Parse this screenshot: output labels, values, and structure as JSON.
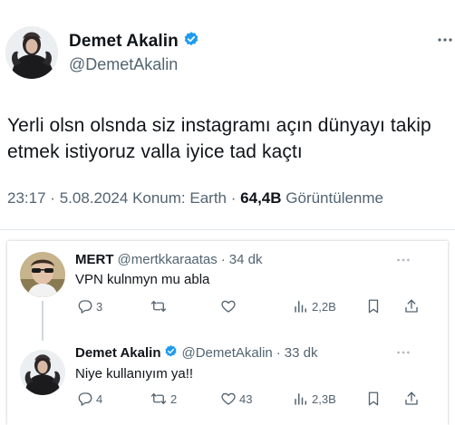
{
  "main_tweet": {
    "author_name": "Demet Akalin",
    "author_handle": "@DemetAkalin",
    "text": "Yerli olsn olsnda siz instagramı açın dünyayı takip etmek istiyoruz valla iyice tad kaçtı",
    "time": "23:17",
    "separator": "·",
    "date": "5.08.2024",
    "location": "Konum: Earth",
    "views_count": "64,4B",
    "views_label": "Görüntülenme",
    "icons": {
      "verified": "verified-badge-icon",
      "more": "more-dots-icon"
    },
    "colors": {
      "verified": "#1d9bf0",
      "secondary_text": "#536471"
    }
  },
  "replies": [
    {
      "author_name": "MERT",
      "author_handle": "@mertkkaraatas",
      "time_sep": "·",
      "time": "34 dk",
      "text": "VPN kulnmyn mu abla",
      "replies_count": "3",
      "retweets_count": "",
      "likes_count": "",
      "views_count": "2,2B",
      "verified": false
    },
    {
      "author_name": "Demet Akalin",
      "author_handle": "@DemetAkalin",
      "time_sep": "·",
      "time": "33 dk",
      "text": "Niye kullanıyım ya!!",
      "replies_count": "4",
      "retweets_count": "2",
      "likes_count": "43",
      "views_count": "2,3B",
      "verified": true
    }
  ]
}
